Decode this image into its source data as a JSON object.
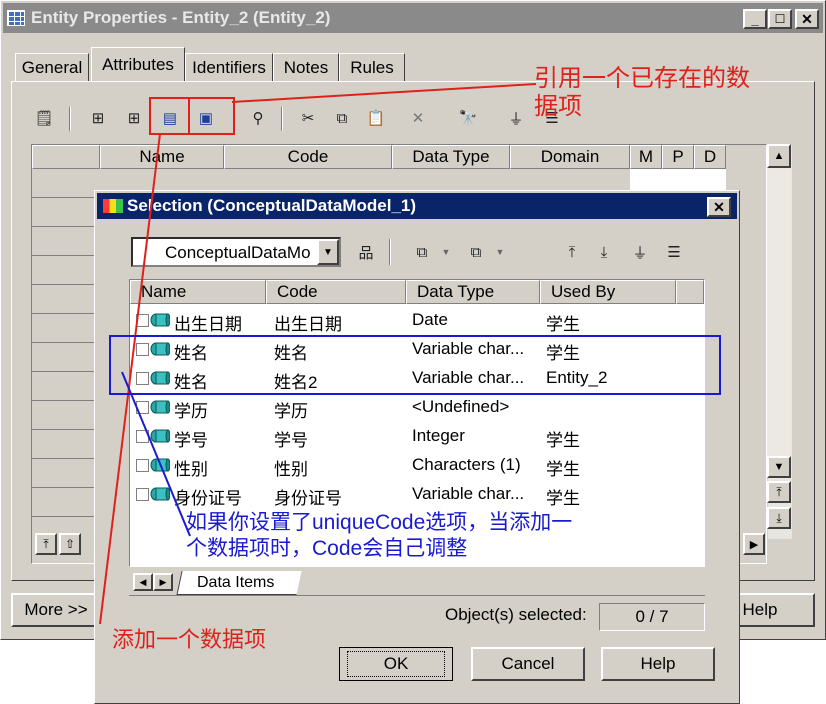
{
  "window": {
    "title": "Entity Properties - Entity_2 (Entity_2)",
    "tabs": [
      "General",
      "Attributes",
      "Identifiers",
      "Notes",
      "Rules"
    ],
    "columns": [
      "Name",
      "Code",
      "Data Type",
      "Domain",
      "M",
      "P",
      "D"
    ],
    "more_label": "More >>",
    "help_label": "Help"
  },
  "dialog": {
    "title": "Selection (ConceptualDataModel_1)",
    "model_select": "ConceptualDataMo",
    "columns": [
      "Name",
      "Code",
      "Data Type",
      "Used By"
    ],
    "rows": [
      {
        "name": "出生日期",
        "code": "出生日期",
        "type": "Date",
        "used_by": "学生"
      },
      {
        "name": "姓名",
        "code": "姓名",
        "type": "Variable char...",
        "used_by": "学生"
      },
      {
        "name": "姓名",
        "code": "姓名2",
        "type": "Variable char...",
        "used_by": "Entity_2"
      },
      {
        "name": "学历",
        "code": "学历",
        "type": "<Undefined>",
        "used_by": ""
      },
      {
        "name": "学号",
        "code": "学号",
        "type": "Integer",
        "used_by": "学生"
      },
      {
        "name": "性别",
        "code": "性别",
        "type": "Characters (1)",
        "used_by": "学生"
      },
      {
        "name": "身份证号",
        "code": "身份证号",
        "type": "Variable char...",
        "used_by": "学生"
      }
    ],
    "tab_label": "Data Items",
    "selected_label": "Object(s) selected:",
    "selected_value": "0 / 7",
    "ok_label": "OK",
    "cancel_label": "Cancel",
    "help_label": "Help"
  },
  "annotations": {
    "top_right_line1": "引用一个已存在的数",
    "top_right_line2": "据项",
    "middle_line1": "如果你设置了uniqueCode选项，当添加一",
    "middle_line2": "个数据项时，Code会自己调整",
    "bottom_left": "添加一个数据项"
  },
  "colors": {
    "title_blue": "#0a246a",
    "face": "#d4d0c8",
    "annotation_red": "#e0201a",
    "annotation_blue": "#1a1ad0"
  }
}
